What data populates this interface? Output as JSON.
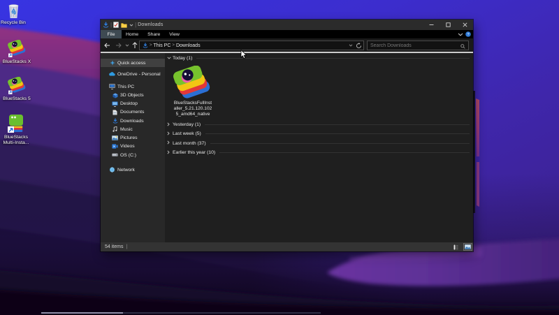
{
  "desktop": {
    "icons": {
      "recycle_bin": {
        "label": "Recycle Bin"
      },
      "bluestacks_x": {
        "label": "BlueStacks X"
      },
      "bluestacks_5": {
        "label": "BlueStacks 5"
      },
      "bluestacks_multi": {
        "label_line1": "BlueStacks",
        "label_line2": "Multi-Insta..."
      }
    }
  },
  "window": {
    "titlebar": {
      "title": "Downloads"
    },
    "menubar": {
      "file": "File",
      "home": "Home",
      "share": "Share",
      "view": "View"
    },
    "addressbar": {
      "crumb_root": "This PC",
      "crumb_current": "Downloads",
      "search_placeholder": "Search Downloads"
    },
    "sidebar": {
      "items": [
        {
          "label": "Quick access"
        },
        {
          "label": "OneDrive - Personal"
        },
        {
          "label": "This PC"
        },
        {
          "label": "3D Objects"
        },
        {
          "label": "Desktop"
        },
        {
          "label": "Documents"
        },
        {
          "label": "Downloads"
        },
        {
          "label": "Music"
        },
        {
          "label": "Pictures"
        },
        {
          "label": "Videos"
        },
        {
          "label": "OS (C:)"
        },
        {
          "label": "Network"
        }
      ]
    },
    "content": {
      "groups": [
        {
          "label": "Today (1)"
        },
        {
          "label": "Yesterday (1)"
        },
        {
          "label": "Last week (5)"
        },
        {
          "label": "Last month (37)"
        },
        {
          "label": "Earlier this year (10)"
        }
      ],
      "file": {
        "name_line1": "BlueStacksFullInst",
        "name_line2": "aller_5.21.120.102",
        "name_line3": "5_amd64_native"
      }
    },
    "statusbar": {
      "count": "54 items"
    }
  },
  "colors": {
    "accent_download": "#2f7bd8",
    "wallpaper_top": "#3a31d8",
    "wallpaper_magenta": "#8c3087",
    "file_tab_bg": "#3e4a52"
  }
}
